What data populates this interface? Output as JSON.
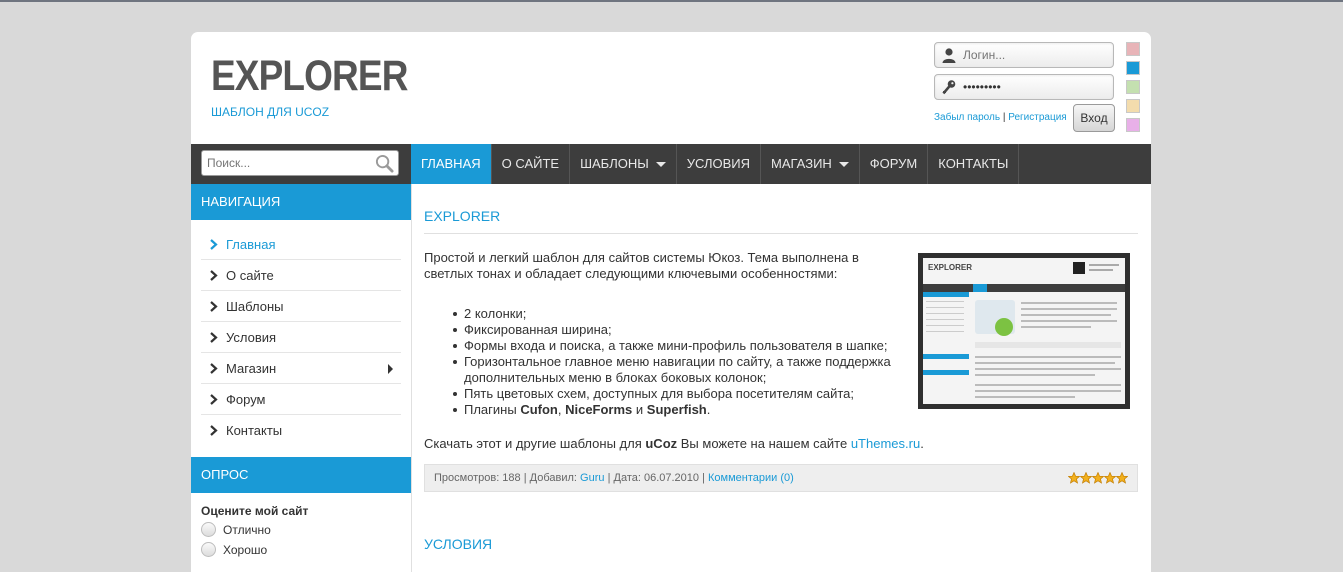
{
  "header": {
    "logo_title": "EXPLORER",
    "logo_subtitle": "ШАБЛОН ДЛЯ UCOZ"
  },
  "login": {
    "login_placeholder": "Логин...",
    "password_value": "•••••••••",
    "forgot_link": "Забыл пароль",
    "separator": "|",
    "register_link": "Регистрация",
    "submit_label": "Вход"
  },
  "color_schemes": [
    "#e8b4b8",
    "#1a9ad6",
    "#c4e0b0",
    "#f3dcad",
    "#e8b0e8"
  ],
  "search": {
    "placeholder": "Поиск..."
  },
  "menu": [
    {
      "label": "ГЛАВНАЯ",
      "active": true,
      "dropdown": false
    },
    {
      "label": "О САЙТЕ",
      "active": false,
      "dropdown": false
    },
    {
      "label": "ШАБЛОНЫ",
      "active": false,
      "dropdown": true
    },
    {
      "label": "УСЛОВИЯ",
      "active": false,
      "dropdown": false
    },
    {
      "label": "МАГАЗИН",
      "active": false,
      "dropdown": true
    },
    {
      "label": "ФОРУМ",
      "active": false,
      "dropdown": false
    },
    {
      "label": "КОНТАКТЫ",
      "active": false,
      "dropdown": false
    }
  ],
  "sidebar": {
    "nav_title": "НАВИГАЦИЯ",
    "nav_items": [
      {
        "label": "Главная",
        "active": true,
        "submenu": false
      },
      {
        "label": "О сайте",
        "active": false,
        "submenu": false
      },
      {
        "label": "Шаблоны",
        "active": false,
        "submenu": false
      },
      {
        "label": "Условия",
        "active": false,
        "submenu": false
      },
      {
        "label": "Магазин",
        "active": false,
        "submenu": true
      },
      {
        "label": "Форум",
        "active": false,
        "submenu": false
      },
      {
        "label": "Контакты",
        "active": false,
        "submenu": false
      }
    ],
    "poll_title": "ОПРОС",
    "poll_question": "Оцените мой сайт",
    "poll_options": [
      "Отлично",
      "Хорошо"
    ]
  },
  "post": {
    "title": "EXPLORER",
    "intro": "Простой и легкий шаблон для сайтов системы Юкоз. Тема выполнена в светлых тонах и обладает следующими ключевыми особенностями:",
    "features": [
      "2 колонки;",
      "Фиксированная ширина;",
      "Формы входа и поиска, а также мини-профиль пользователя в шапке;",
      "Горизонтальное главное меню навигации по сайту, а также поддержка дополнительных меню в блоках боковых колонок;",
      "Пять цветовых схем, доступных для выбора посетителям сайта;"
    ],
    "plugins_prefix": "Плагины ",
    "plugin_1": "Cufon",
    "plugin_sep_1": ", ",
    "plugin_2": "NiceForms",
    "plugin_sep_2": " и ",
    "plugin_3": "Superfish",
    "plugins_suffix": ".",
    "download_prefix": "Скачать этот и другие шаблоны для ",
    "download_brand": "uCoz",
    "download_middle": " Вы можете на нашем сайте ",
    "download_link": "uThemes.ru",
    "download_suffix": ".",
    "meta": {
      "views_label": "Просмотров: 188",
      "sep": " | ",
      "added_label": "Добавил: ",
      "author": "Guru",
      "date_label": "Дата: 06.07.2010",
      "comments": "Комментарии (0)"
    },
    "rating_stars": 5
  },
  "post2": {
    "title": "УСЛОВИЯ"
  }
}
